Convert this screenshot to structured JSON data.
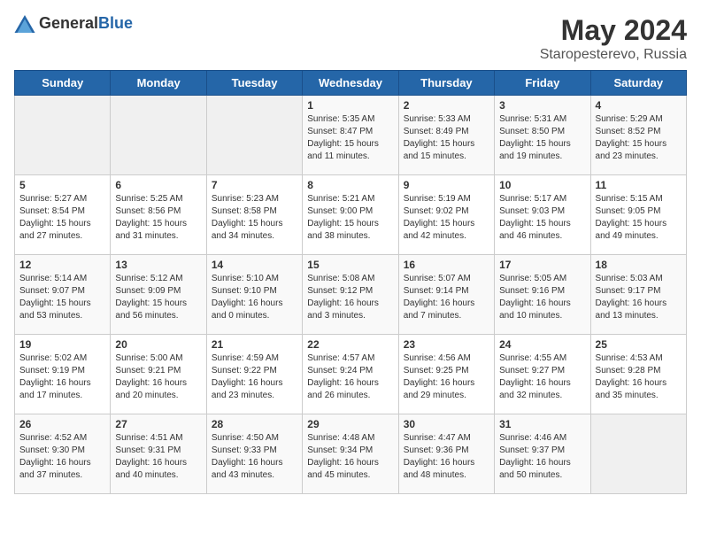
{
  "header": {
    "logo_general": "General",
    "logo_blue": "Blue",
    "title": "May 2024",
    "subtitle": "Staropesterevo, Russia"
  },
  "weekdays": [
    "Sunday",
    "Monday",
    "Tuesday",
    "Wednesday",
    "Thursday",
    "Friday",
    "Saturday"
  ],
  "weeks": [
    [
      {
        "day": "",
        "empty": true
      },
      {
        "day": "",
        "empty": true
      },
      {
        "day": "",
        "empty": true
      },
      {
        "day": "1",
        "sunrise": "Sunrise: 5:35 AM",
        "sunset": "Sunset: 8:47 PM",
        "daylight": "Daylight: 15 hours and 11 minutes."
      },
      {
        "day": "2",
        "sunrise": "Sunrise: 5:33 AM",
        "sunset": "Sunset: 8:49 PM",
        "daylight": "Daylight: 15 hours and 15 minutes."
      },
      {
        "day": "3",
        "sunrise": "Sunrise: 5:31 AM",
        "sunset": "Sunset: 8:50 PM",
        "daylight": "Daylight: 15 hours and 19 minutes."
      },
      {
        "day": "4",
        "sunrise": "Sunrise: 5:29 AM",
        "sunset": "Sunset: 8:52 PM",
        "daylight": "Daylight: 15 hours and 23 minutes."
      }
    ],
    [
      {
        "day": "5",
        "sunrise": "Sunrise: 5:27 AM",
        "sunset": "Sunset: 8:54 PM",
        "daylight": "Daylight: 15 hours and 27 minutes."
      },
      {
        "day": "6",
        "sunrise": "Sunrise: 5:25 AM",
        "sunset": "Sunset: 8:56 PM",
        "daylight": "Daylight: 15 hours and 31 minutes."
      },
      {
        "day": "7",
        "sunrise": "Sunrise: 5:23 AM",
        "sunset": "Sunset: 8:58 PM",
        "daylight": "Daylight: 15 hours and 34 minutes."
      },
      {
        "day": "8",
        "sunrise": "Sunrise: 5:21 AM",
        "sunset": "Sunset: 9:00 PM",
        "daylight": "Daylight: 15 hours and 38 minutes."
      },
      {
        "day": "9",
        "sunrise": "Sunrise: 5:19 AM",
        "sunset": "Sunset: 9:02 PM",
        "daylight": "Daylight: 15 hours and 42 minutes."
      },
      {
        "day": "10",
        "sunrise": "Sunrise: 5:17 AM",
        "sunset": "Sunset: 9:03 PM",
        "daylight": "Daylight: 15 hours and 46 minutes."
      },
      {
        "day": "11",
        "sunrise": "Sunrise: 5:15 AM",
        "sunset": "Sunset: 9:05 PM",
        "daylight": "Daylight: 15 hours and 49 minutes."
      }
    ],
    [
      {
        "day": "12",
        "sunrise": "Sunrise: 5:14 AM",
        "sunset": "Sunset: 9:07 PM",
        "daylight": "Daylight: 15 hours and 53 minutes."
      },
      {
        "day": "13",
        "sunrise": "Sunrise: 5:12 AM",
        "sunset": "Sunset: 9:09 PM",
        "daylight": "Daylight: 15 hours and 56 minutes."
      },
      {
        "day": "14",
        "sunrise": "Sunrise: 5:10 AM",
        "sunset": "Sunset: 9:10 PM",
        "daylight": "Daylight: 16 hours and 0 minutes."
      },
      {
        "day": "15",
        "sunrise": "Sunrise: 5:08 AM",
        "sunset": "Sunset: 9:12 PM",
        "daylight": "Daylight: 16 hours and 3 minutes."
      },
      {
        "day": "16",
        "sunrise": "Sunrise: 5:07 AM",
        "sunset": "Sunset: 9:14 PM",
        "daylight": "Daylight: 16 hours and 7 minutes."
      },
      {
        "day": "17",
        "sunrise": "Sunrise: 5:05 AM",
        "sunset": "Sunset: 9:16 PM",
        "daylight": "Daylight: 16 hours and 10 minutes."
      },
      {
        "day": "18",
        "sunrise": "Sunrise: 5:03 AM",
        "sunset": "Sunset: 9:17 PM",
        "daylight": "Daylight: 16 hours and 13 minutes."
      }
    ],
    [
      {
        "day": "19",
        "sunrise": "Sunrise: 5:02 AM",
        "sunset": "Sunset: 9:19 PM",
        "daylight": "Daylight: 16 hours and 17 minutes."
      },
      {
        "day": "20",
        "sunrise": "Sunrise: 5:00 AM",
        "sunset": "Sunset: 9:21 PM",
        "daylight": "Daylight: 16 hours and 20 minutes."
      },
      {
        "day": "21",
        "sunrise": "Sunrise: 4:59 AM",
        "sunset": "Sunset: 9:22 PM",
        "daylight": "Daylight: 16 hours and 23 minutes."
      },
      {
        "day": "22",
        "sunrise": "Sunrise: 4:57 AM",
        "sunset": "Sunset: 9:24 PM",
        "daylight": "Daylight: 16 hours and 26 minutes."
      },
      {
        "day": "23",
        "sunrise": "Sunrise: 4:56 AM",
        "sunset": "Sunset: 9:25 PM",
        "daylight": "Daylight: 16 hours and 29 minutes."
      },
      {
        "day": "24",
        "sunrise": "Sunrise: 4:55 AM",
        "sunset": "Sunset: 9:27 PM",
        "daylight": "Daylight: 16 hours and 32 minutes."
      },
      {
        "day": "25",
        "sunrise": "Sunrise: 4:53 AM",
        "sunset": "Sunset: 9:28 PM",
        "daylight": "Daylight: 16 hours and 35 minutes."
      }
    ],
    [
      {
        "day": "26",
        "sunrise": "Sunrise: 4:52 AM",
        "sunset": "Sunset: 9:30 PM",
        "daylight": "Daylight: 16 hours and 37 minutes."
      },
      {
        "day": "27",
        "sunrise": "Sunrise: 4:51 AM",
        "sunset": "Sunset: 9:31 PM",
        "daylight": "Daylight: 16 hours and 40 minutes."
      },
      {
        "day": "28",
        "sunrise": "Sunrise: 4:50 AM",
        "sunset": "Sunset: 9:33 PM",
        "daylight": "Daylight: 16 hours and 43 minutes."
      },
      {
        "day": "29",
        "sunrise": "Sunrise: 4:48 AM",
        "sunset": "Sunset: 9:34 PM",
        "daylight": "Daylight: 16 hours and 45 minutes."
      },
      {
        "day": "30",
        "sunrise": "Sunrise: 4:47 AM",
        "sunset": "Sunset: 9:36 PM",
        "daylight": "Daylight: 16 hours and 48 minutes."
      },
      {
        "day": "31",
        "sunrise": "Sunrise: 4:46 AM",
        "sunset": "Sunset: 9:37 PM",
        "daylight": "Daylight: 16 hours and 50 minutes."
      },
      {
        "day": "",
        "empty": true
      }
    ]
  ]
}
